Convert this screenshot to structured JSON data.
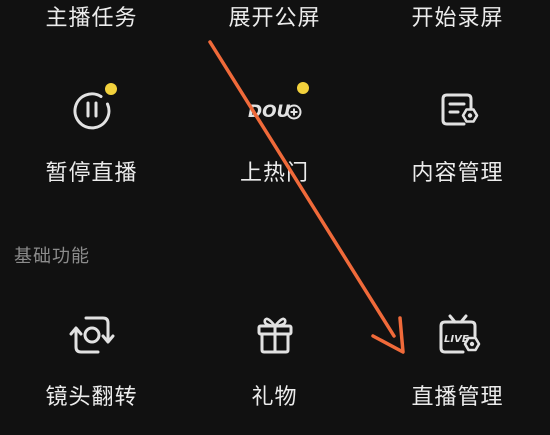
{
  "colors": {
    "background": "#111111",
    "text": "#ececec",
    "section_text": "#8c8c8c",
    "icon_stroke": "#e2e2e2",
    "notify_dot": "#f2d13c",
    "annotation_arrow": "#f06a3a"
  },
  "top_row": [
    {
      "label": "主播任务"
    },
    {
      "label": "展开公屏"
    },
    {
      "label": "开始录屏"
    }
  ],
  "middle_row": [
    {
      "label": "暂停直播",
      "icon": "pause-circle-icon",
      "badge_dot": true
    },
    {
      "label": "上热门",
      "icon": "douyin-plus-icon",
      "icon_text": "DOU",
      "badge_dot": true
    },
    {
      "label": "内容管理",
      "icon": "document-settings-icon",
      "badge_dot": false
    }
  ],
  "section": {
    "title": "基础功能"
  },
  "bottom_row": [
    {
      "label": "镜头翻转",
      "icon": "camera-flip-icon"
    },
    {
      "label": "礼物",
      "icon": "gift-icon"
    },
    {
      "label": "直播管理",
      "icon": "live-tv-settings-icon",
      "icon_text": "LIVE"
    }
  ]
}
